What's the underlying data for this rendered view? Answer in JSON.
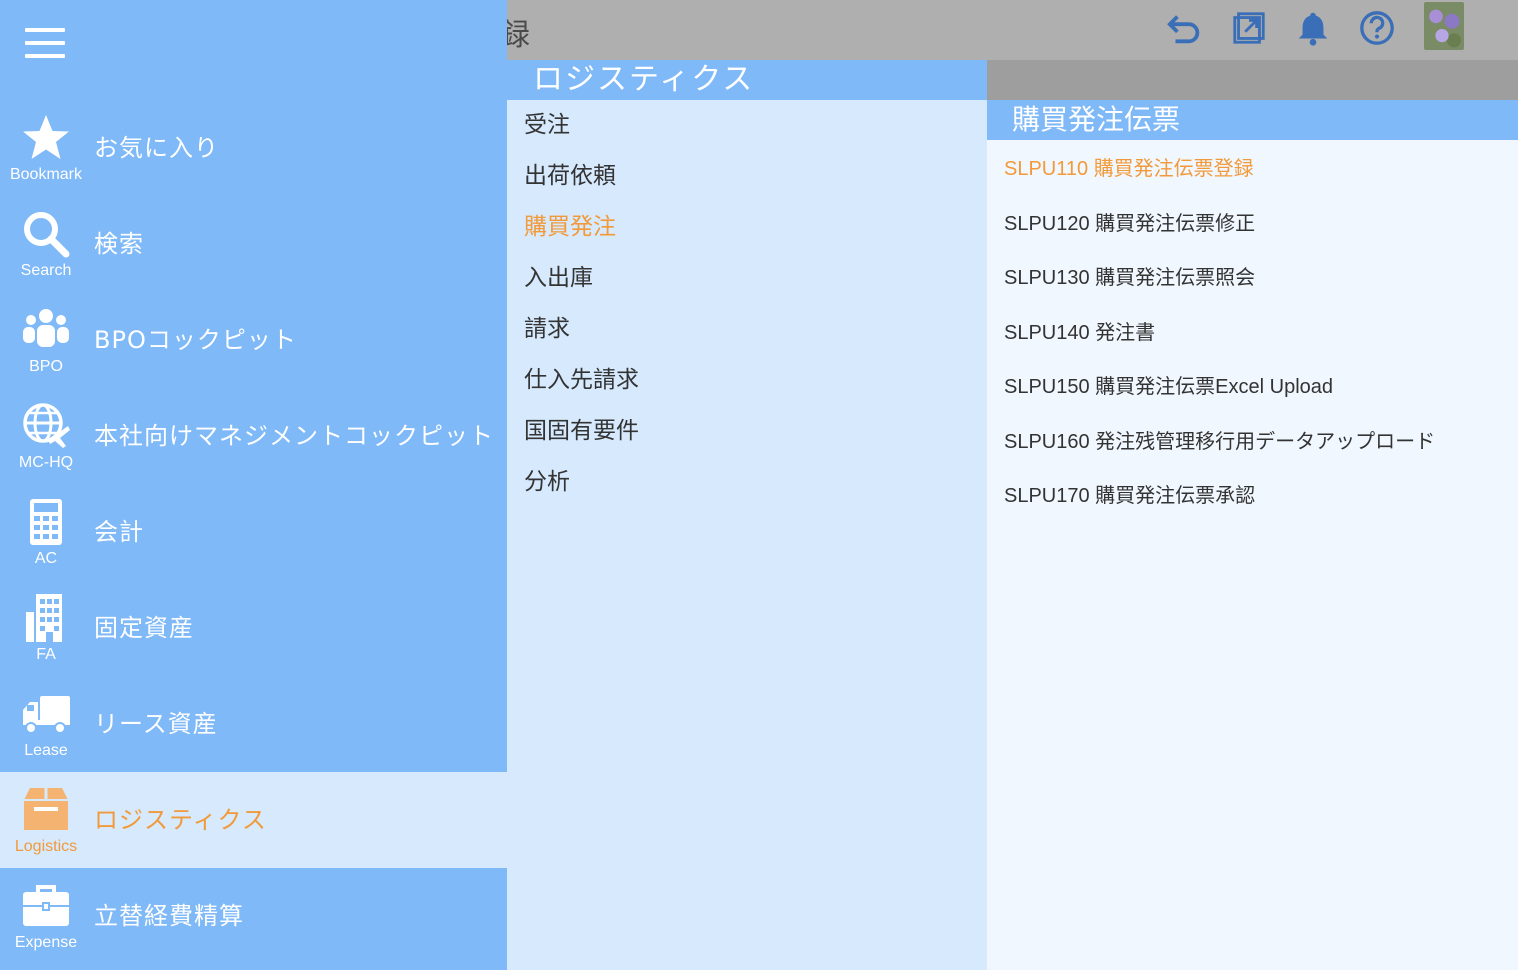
{
  "header": {
    "background_title": "録",
    "icons": [
      "undo-icon",
      "external-link-icon",
      "bell-icon",
      "help-icon"
    ]
  },
  "colors": {
    "sidebar": "#7fb9f7",
    "active_bg": "#d6e9fd",
    "accent": "#f29a3a",
    "panel_bg": "#f0f7fe"
  },
  "sidebar": {
    "items": [
      {
        "icon": "star-icon",
        "sub": "Bookmark",
        "label": "お気に入り"
      },
      {
        "icon": "search-icon",
        "sub": "Search",
        "label": "検索"
      },
      {
        "icon": "users-icon",
        "sub": "BPO",
        "label": "BPOコックピット"
      },
      {
        "icon": "globe-plane-icon",
        "sub": "MC-HQ",
        "label": "本社向けマネジメントコックピット"
      },
      {
        "icon": "calculator-icon",
        "sub": "AC",
        "label": "会計"
      },
      {
        "icon": "building-icon",
        "sub": "FA",
        "label": "固定資産"
      },
      {
        "icon": "truck-icon",
        "sub": "Lease",
        "label": "リース資産"
      },
      {
        "icon": "box-icon",
        "sub": "Logistics",
        "label": "ロジスティクス"
      },
      {
        "icon": "briefcase-icon",
        "sub": "Expense",
        "label": "立替経費精算"
      }
    ],
    "active_index": 7
  },
  "middle": {
    "title": "ロジスティクス",
    "items": [
      "受注",
      "出荷依頼",
      "購買発注",
      "入出庫",
      "請求",
      "仕入先請求",
      "国固有要件",
      "分析"
    ],
    "active_index": 2
  },
  "right": {
    "title": "購買発注伝票",
    "items": [
      "SLPU110 購買発注伝票登録",
      "SLPU120 購買発注伝票修正",
      "SLPU130 購買発注伝票照会",
      "SLPU140 発注書",
      "SLPU150 購買発注伝票Excel Upload",
      "SLPU160 発注残管理移行用データアップロード",
      "SLPU170 購買発注伝票承認"
    ],
    "active_index": 0
  }
}
